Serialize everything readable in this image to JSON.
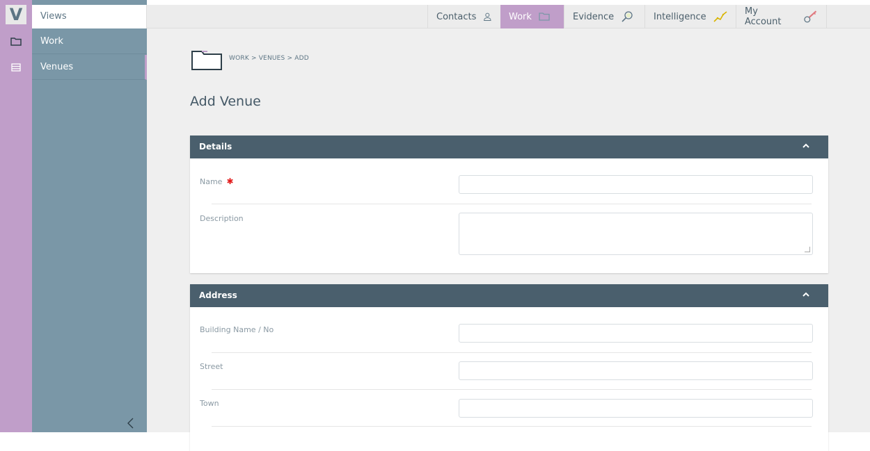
{
  "sidebar": {
    "logo": "V",
    "header": "Views",
    "items": [
      {
        "label": "Work",
        "icon": "folder-icon"
      },
      {
        "label": "Venues",
        "icon": "list-icon"
      }
    ]
  },
  "topnav": [
    {
      "label": "Contacts",
      "icon": "person-icon"
    },
    {
      "label": "Work",
      "icon": "folder-icon",
      "active": true
    },
    {
      "label": "Evidence",
      "icon": "magnifier-icon"
    },
    {
      "label": "Intelligence",
      "icon": "chart-line-icon"
    },
    {
      "label": "My Account",
      "icon": "key-icon"
    }
  ],
  "breadcrumb": {
    "items": [
      "WORK",
      "VENUES",
      "ADD"
    ],
    "separator": ">"
  },
  "page_title": "Add Venue",
  "details": {
    "title": "Details",
    "fields": [
      {
        "label": "Name",
        "required": true,
        "value": ""
      },
      {
        "label": "Description",
        "value": ""
      }
    ]
  },
  "address": {
    "title": "Address",
    "fields": [
      {
        "label": "Building Name / No",
        "value": ""
      },
      {
        "label": "Street",
        "value": ""
      },
      {
        "label": "Town",
        "value": ""
      }
    ]
  },
  "colors": {
    "accent": "#c09ec9",
    "sidebar": "#7a97a7",
    "panel_header": "#4a5f6d",
    "required": "#e21b1b"
  }
}
